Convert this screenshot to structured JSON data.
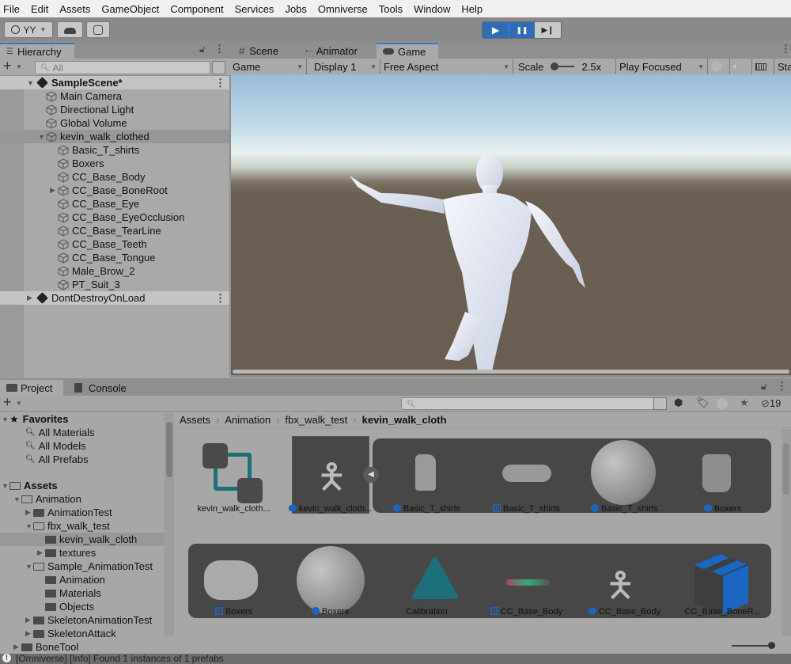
{
  "menubar": [
    "File",
    "Edit",
    "Assets",
    "GameObject",
    "Component",
    "Services",
    "Jobs",
    "Omniverse",
    "Tools",
    "Window",
    "Help"
  ],
  "toolbar": {
    "account": "YY",
    "cloud_icon": "cloud-icon",
    "collab_icon": "collab-icon",
    "play": "▶",
    "pause": "❚❚",
    "step": "▶❙"
  },
  "hierarchy": {
    "tab": "Hierarchy",
    "search_placeholder": "All",
    "scene": "SampleScene*",
    "items": [
      {
        "label": "Main Camera",
        "depth": 1
      },
      {
        "label": "Directional Light",
        "depth": 1
      },
      {
        "label": "Global Volume",
        "depth": 1
      },
      {
        "label": "kevin_walk_clothed",
        "depth": 1,
        "expanded": true
      },
      {
        "label": "Basic_T_shirts",
        "depth": 2
      },
      {
        "label": "Boxers",
        "depth": 2
      },
      {
        "label": "CC_Base_Body",
        "depth": 2
      },
      {
        "label": "CC_Base_BoneRoot",
        "depth": 2,
        "collapsed": true
      },
      {
        "label": "CC_Base_Eye",
        "depth": 2
      },
      {
        "label": "CC_Base_EyeOcclusion",
        "depth": 2
      },
      {
        "label": "CC_Base_TearLine",
        "depth": 2
      },
      {
        "label": "CC_Base_Teeth",
        "depth": 2
      },
      {
        "label": "CC_Base_Tongue",
        "depth": 2
      },
      {
        "label": "Male_Brow_2",
        "depth": 2
      },
      {
        "label": "PT_Suit_3",
        "depth": 2
      }
    ],
    "dont_destroy": "DontDestroyOnLoad"
  },
  "game": {
    "tabs": [
      "Scene",
      "Animator",
      "Game"
    ],
    "active_tab": "Game",
    "view_mode": "Game",
    "display": "Display 1",
    "aspect": "Free Aspect",
    "scale_label": "Scale",
    "scale_value": "2.5x",
    "play_mode": "Play Focused",
    "stats_label": "Sta"
  },
  "project": {
    "tabs": [
      "Project",
      "Console"
    ],
    "hidden_count": "19",
    "favorites": {
      "label": "Favorites",
      "items": [
        "All Materials",
        "All Models",
        "All Prefabs"
      ]
    },
    "assets_label": "Assets",
    "tree": [
      {
        "label": "Animation",
        "depth": 1,
        "state": "open"
      },
      {
        "label": "AnimationTest",
        "depth": 2,
        "state": "closed"
      },
      {
        "label": "fbx_walk_test",
        "depth": 2,
        "state": "open"
      },
      {
        "label": "kevin_walk_cloth",
        "depth": 3,
        "state": "leaf",
        "selected": true
      },
      {
        "label": "textures",
        "depth": 3,
        "state": "closed"
      },
      {
        "label": "Sample_AnimationTest",
        "depth": 2,
        "state": "open"
      },
      {
        "label": "Animation",
        "depth": 3,
        "state": "leaf"
      },
      {
        "label": "Materials",
        "depth": 3,
        "state": "leaf"
      },
      {
        "label": "Objects",
        "depth": 3,
        "state": "leaf"
      },
      {
        "label": "SkeletonAnimationTest",
        "depth": 2,
        "state": "closed"
      },
      {
        "label": "SkeletonAttack",
        "depth": 2,
        "state": "closed"
      },
      {
        "label": "BoneTool",
        "depth": 1,
        "state": "closed"
      }
    ],
    "breadcrumb": [
      "Assets",
      "Animation",
      "fbx_walk_test",
      "kevin_walk_cloth"
    ],
    "grid_row1": [
      {
        "label": "kevin_walk_cloth...",
        "icon": "animator-controller-icon"
      },
      {
        "label": "kevin_walk_cloth...",
        "icon": "model-prefab-icon"
      },
      {
        "label": "Basic_T_shirts",
        "icon": "model-prefab-icon"
      },
      {
        "label": "Basic_T_shirts",
        "icon": "mesh-icon"
      },
      {
        "label": "Basic_T_shirts",
        "icon": "material-icon"
      },
      {
        "label": "Boxers",
        "icon": "model-prefab-icon"
      }
    ],
    "grid_row2": [
      {
        "label": "Boxers",
        "icon": "mesh-icon"
      },
      {
        "label": "Boxers",
        "icon": "material-icon"
      },
      {
        "label": "Calibration",
        "icon": "avatar-icon"
      },
      {
        "label": "CC_Base_Body",
        "icon": "mesh-icon"
      },
      {
        "label": "CC_Base_Body",
        "icon": "model-prefab-icon"
      },
      {
        "label": "CC_Base_BoneR...",
        "icon": "prefab-icon"
      }
    ]
  },
  "status": "[Omniverse] [Info] Found 1 instances of 1 prefabs",
  "colors": {
    "accent": "#2f6cb6",
    "teal": "#1d6f7a",
    "prefab_blue": "#1a66c2"
  }
}
